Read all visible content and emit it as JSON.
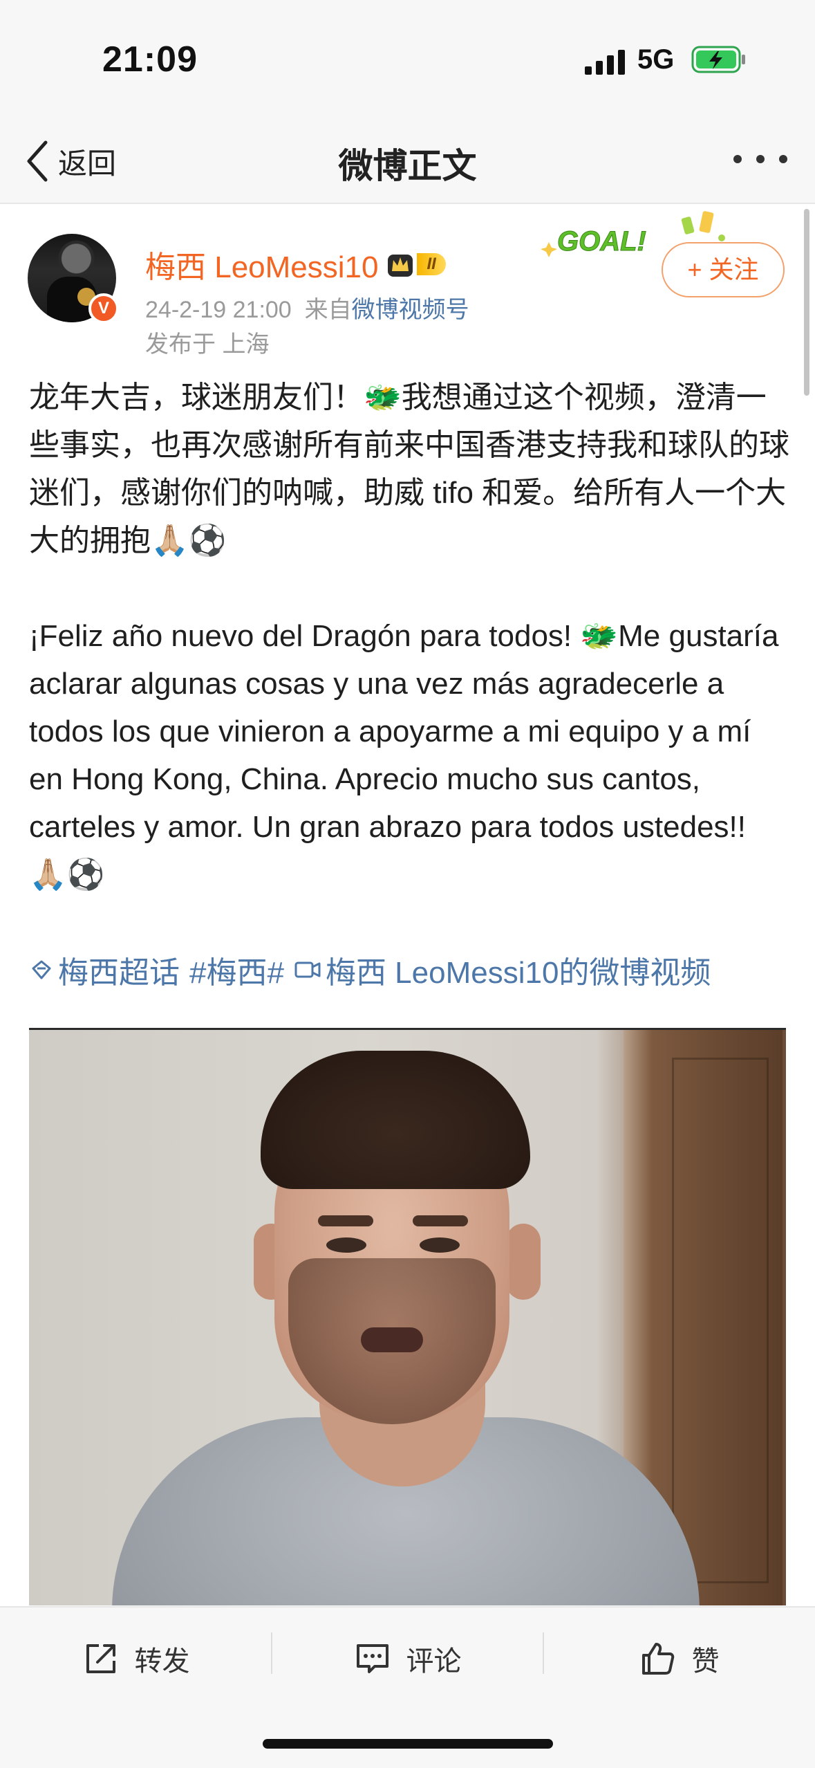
{
  "status_bar": {
    "time": "21:09",
    "network": "5G",
    "icons": [
      "signal-icon",
      "battery-charging-icon"
    ]
  },
  "nav": {
    "back_label": "返回",
    "title": "微博正文",
    "more_icon": "more-icon"
  },
  "post": {
    "author": "梅西 LeoMessi10",
    "vip_level": "II",
    "verified_badge": "V",
    "date": "24-2-19 21:00",
    "source_prefix": "来自",
    "source": "微博视频号",
    "location": "发布于 上海",
    "follow_label": "+ 关注",
    "goal_badge": "GOAL!",
    "paragraph_cn": "龙年大吉，球迷朋友们！🐲我想通过这个视频，澄清一些事实，也再次感谢所有前来中国香港支持我和球队的球迷们，感谢你们的呐喊，助威 tifo 和爱。给所有人一个大大的拥抱🙏🏼⚽",
    "paragraph_es": "¡Feliz año nuevo del Dragón para todos! 🐲Me gustaría aclarar algunas cosas y una vez más agradecerle a todos los que vinieron a apoyarme a mi equipo y a mí en Hong Kong, China. Aprecio mucho sus cantos, carteles y amor. Un gran abrazo para todos ustedes!! 🙏🏼⚽",
    "tags": [
      {
        "icon": "super-topic-icon",
        "label": "梅西超话"
      },
      {
        "icon": "",
        "label": "#梅西#"
      },
      {
        "icon": "video-icon",
        "label": "梅西 LeoMessi10的微博视频"
      }
    ]
  },
  "actions": {
    "repost": "转发",
    "comment": "评论",
    "like": "赞"
  },
  "colors": {
    "accent_orange": "#f26522",
    "link_blue": "#4d77a8",
    "meta_gray": "#9a9a9a"
  }
}
